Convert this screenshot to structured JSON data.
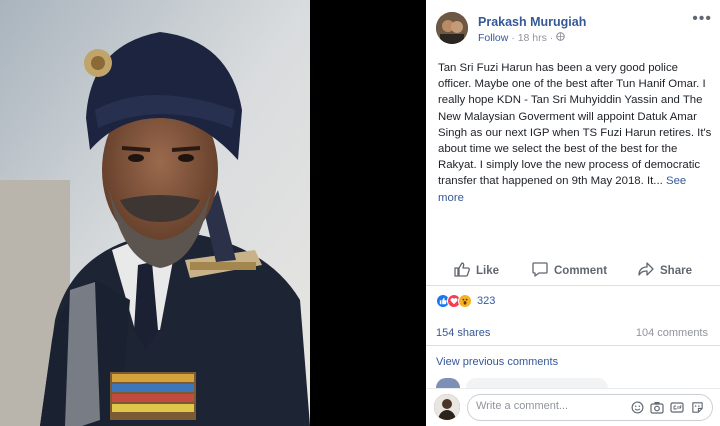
{
  "post": {
    "author": "Prakash Murugiah",
    "follow_label": "Follow",
    "separator": "·",
    "time": "18 hrs",
    "separator2": "·",
    "more_menu": "•••",
    "text": "Tan Sri Fuzi Harun has been a very good police officer. Maybe one of the best after Tun Hanif Omar. I really hope KDN - Tan Sri Muhyiddin Yassin and The New Malaysian Goverment will appoint Datuk Amar Singh as our next IGP when TS Fuzi Harun retires. It's about time we select the best of the best for the Rakyat. I simply love the new process of democratic transfer that happened on 9th May 2018. It...",
    "see_more": "See more"
  },
  "actions": {
    "like": "Like",
    "comment": "Comment",
    "share": "Share"
  },
  "stats": {
    "reactions_count": "323",
    "shares": "154 shares",
    "comments": "104 comments"
  },
  "comments_section": {
    "view_previous": "View previous comments",
    "input_placeholder": "Write a comment..."
  },
  "colors": {
    "link": "#365899",
    "like_blue": "#1877f2",
    "love_red": "#f33e58",
    "wow_yellow": "#f7b125"
  }
}
